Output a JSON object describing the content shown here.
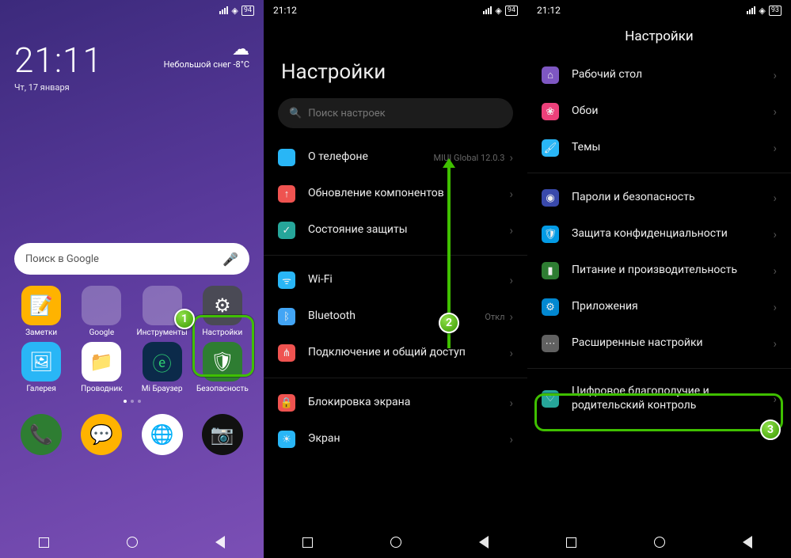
{
  "panel1": {
    "time": "21:11",
    "date": "Чт, 17 января",
    "weather_text": "Небольшой снег",
    "weather_temp": "-8°C",
    "search_placeholder": "Поиск в Google",
    "apps_row1": [
      {
        "label": "Заметки",
        "bg": "#ffb300"
      },
      {
        "label": "Google",
        "bg": ""
      },
      {
        "label": "Инструменты",
        "bg": ""
      },
      {
        "label": "Настройки",
        "bg": "#4a4a55"
      }
    ],
    "apps_row2": [
      {
        "label": "Галерея",
        "bg": "#29b6f6"
      },
      {
        "label": "Проводник",
        "bg": "#fff"
      },
      {
        "label": "Mi Браузер",
        "bg": "#0b2a4a"
      },
      {
        "label": "Безопасность",
        "bg": "#2e7d32"
      }
    ],
    "dock": [
      {
        "bg": "#2e7d32"
      },
      {
        "bg": "#ffb300"
      },
      {
        "bg": "#fff"
      },
      {
        "bg": "#111"
      }
    ]
  },
  "panel2": {
    "status_time": "21:12",
    "battery": "94",
    "title": "Настройки",
    "search_placeholder": "Поиск настроек",
    "rows": [
      {
        "icon_bg": "#29b6f6",
        "label": "О телефоне",
        "sub": "MIUI Global 12.0.3"
      },
      {
        "icon_bg": "#ef5350",
        "label": "Обновление компонентов"
      },
      {
        "icon_bg": "#26a69a",
        "label": "Состояние защиты"
      }
    ],
    "rows2": [
      {
        "icon_bg": "#29b6f6",
        "label": "Wi-Fi",
        "sub": ""
      },
      {
        "icon_bg": "#42a5f5",
        "label": "Bluetooth",
        "sub": "Откл"
      },
      {
        "icon_bg": "#ef5350",
        "label": "Подключение и общий доступ"
      }
    ],
    "rows3": [
      {
        "icon_bg": "#ef5350",
        "label": "Блокировка экрана"
      },
      {
        "icon_bg": "#29b6f6",
        "label": "Экран"
      }
    ]
  },
  "panel3": {
    "status_time": "21:12",
    "battery": "93",
    "title": "Настройки",
    "rowsA": [
      {
        "icon_bg": "#7e57c2",
        "label": "Рабочий стол"
      },
      {
        "icon_bg": "#ec407a",
        "label": "Обои"
      },
      {
        "icon_bg": "#29b6f6",
        "label": "Темы"
      }
    ],
    "rowsB": [
      {
        "icon_bg": "#3949ab",
        "label": "Пароли и безопасность"
      },
      {
        "icon_bg": "#039be5",
        "label": "Защита конфиденциальности"
      },
      {
        "icon_bg": "#2e7d32",
        "label": "Питание и производительность"
      },
      {
        "icon_bg": "#0288d1",
        "label": "Приложения"
      },
      {
        "icon_bg": "#616161",
        "label": "Расширенные настройки"
      }
    ],
    "rowsC": [
      {
        "icon_bg": "#26a69a",
        "label": "Цифровое благополучие и родительский контроль"
      }
    ]
  },
  "badges": {
    "b1": "1",
    "b2": "2",
    "b3": "3"
  }
}
